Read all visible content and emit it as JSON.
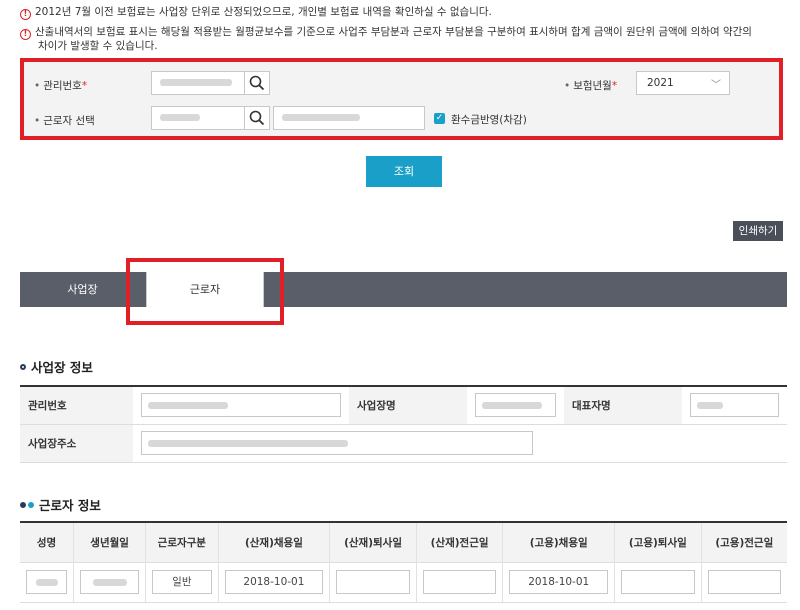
{
  "notices": {
    "n1": "2012년 7월 이전 보험료는 사업장 단위로 산정되었으므로, 개인별 보험료 내역을 확인하실 수 없습니다.",
    "n2": "산출내역서의 보험료 표시는 해당월 적용받는 월평균보수를 기준으로 사업주 부담분과 근로자 부담분을 구분하여 표시하며 합계 금액이 원단위 금액에 의하여 약간의",
    "n2_cont": "차이가 발생할 수 있습니다."
  },
  "search": {
    "mgmt_label": "관리번호",
    "worker_label": "근로자 선택",
    "year_label": "보험년월",
    "year_value": "2021",
    "refund_label": "환수금반영(차감)"
  },
  "buttons": {
    "query": "조회",
    "print": "인쇄하기"
  },
  "tabs": {
    "business": "사업장",
    "worker": "근로자"
  },
  "biz_section": {
    "title": "사업장 정보",
    "mgmt_no": "관리번호",
    "name": "사업장명",
    "rep": "대표자명",
    "address": "사업장주소"
  },
  "worker_section": {
    "title": "근로자 정보",
    "columns": [
      "성명",
      "생년월일",
      "근로자구분",
      "(산재)채용일",
      "(산재)퇴사일",
      "(산재)전근일",
      "(고용)채용일",
      "(고용)퇴사일",
      "(고용)전근일"
    ],
    "row": {
      "type": "일반",
      "ind_hire": "2018-10-01",
      "emp_hire": "2018-10-01"
    }
  },
  "colors": {
    "accent": "#1aa0c8",
    "highlight": "#e01f26",
    "tabbar": "#5a5e68"
  }
}
